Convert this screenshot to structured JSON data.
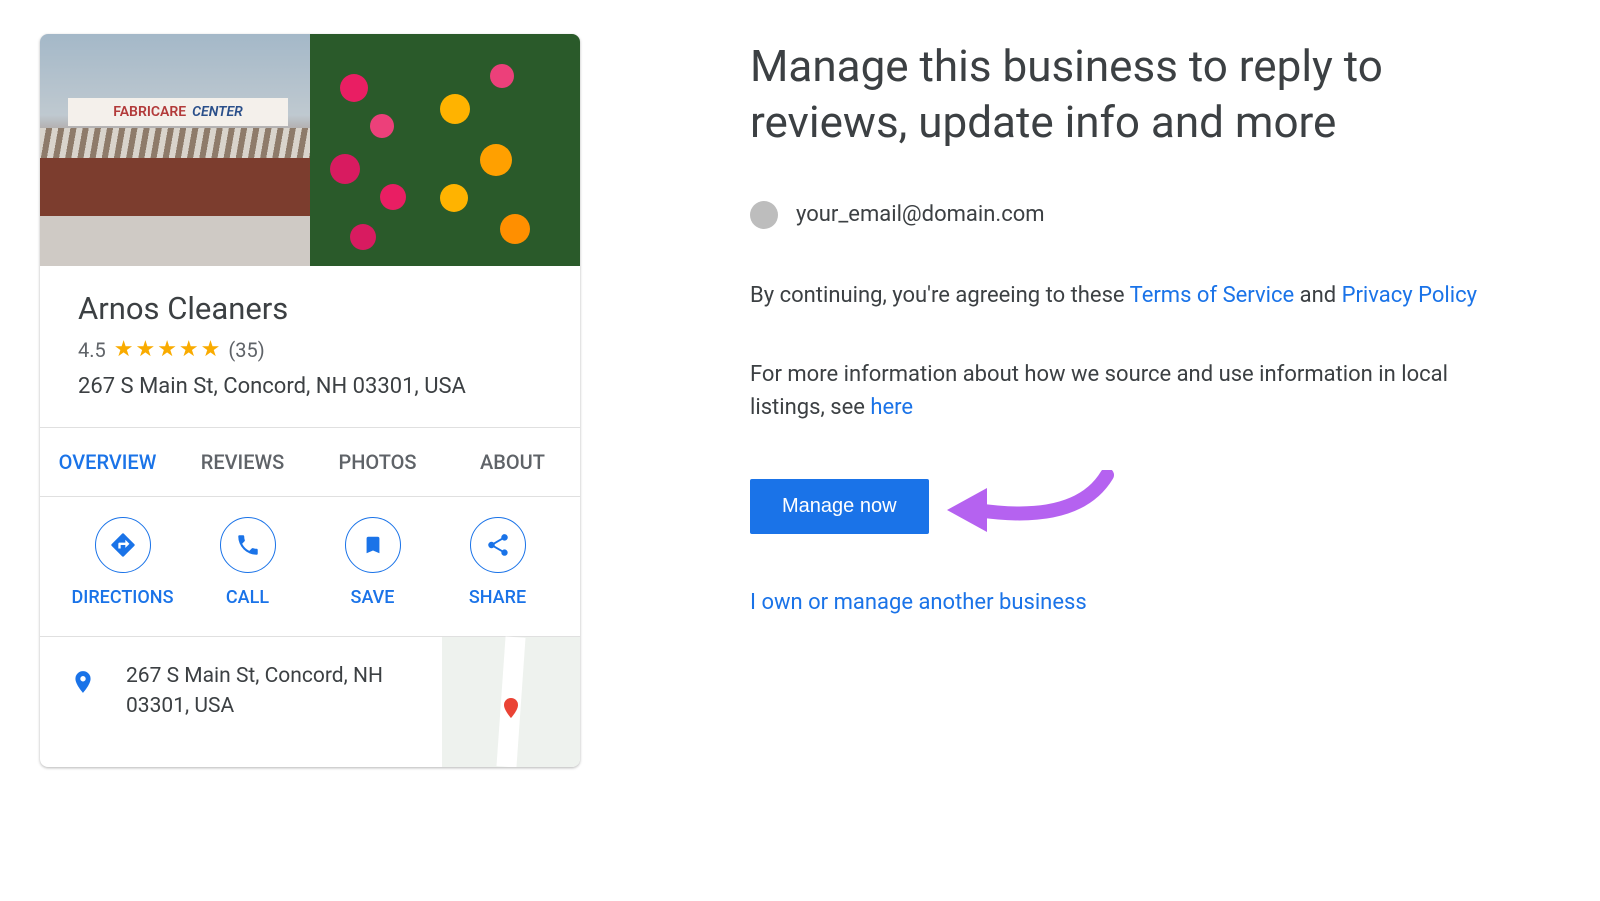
{
  "card": {
    "business_name": "Arnos Cleaners",
    "rating": "4.5",
    "review_count": "(35)",
    "address": "267 S Main St, Concord, NH 03301, USA",
    "storefront_word1": "FABRICARE",
    "storefront_word2": "CENTER"
  },
  "tabs": {
    "overview": "OVERVIEW",
    "reviews": "REVIEWS",
    "photos": "PHOTOS",
    "about": "ABOUT"
  },
  "actions": {
    "directions": "DIRECTIONS",
    "call": "CALL",
    "save": "SAVE",
    "share": "SHARE"
  },
  "addr_block": {
    "text": "267 S Main St, Concord, NH 03301, USA"
  },
  "right": {
    "headline": "Manage this business to reply to reviews, update info and more",
    "email": "your_email@domain.com",
    "terms_prefix": "By continuing, you're agreeing to these ",
    "tos": "Terms of Service",
    "and": " and ",
    "privacy": "Privacy Policy",
    "info_prefix": "For more information about how we source and use information in local listings, see ",
    "here": "here",
    "manage_btn": "Manage now",
    "another": "I own or manage another business"
  }
}
